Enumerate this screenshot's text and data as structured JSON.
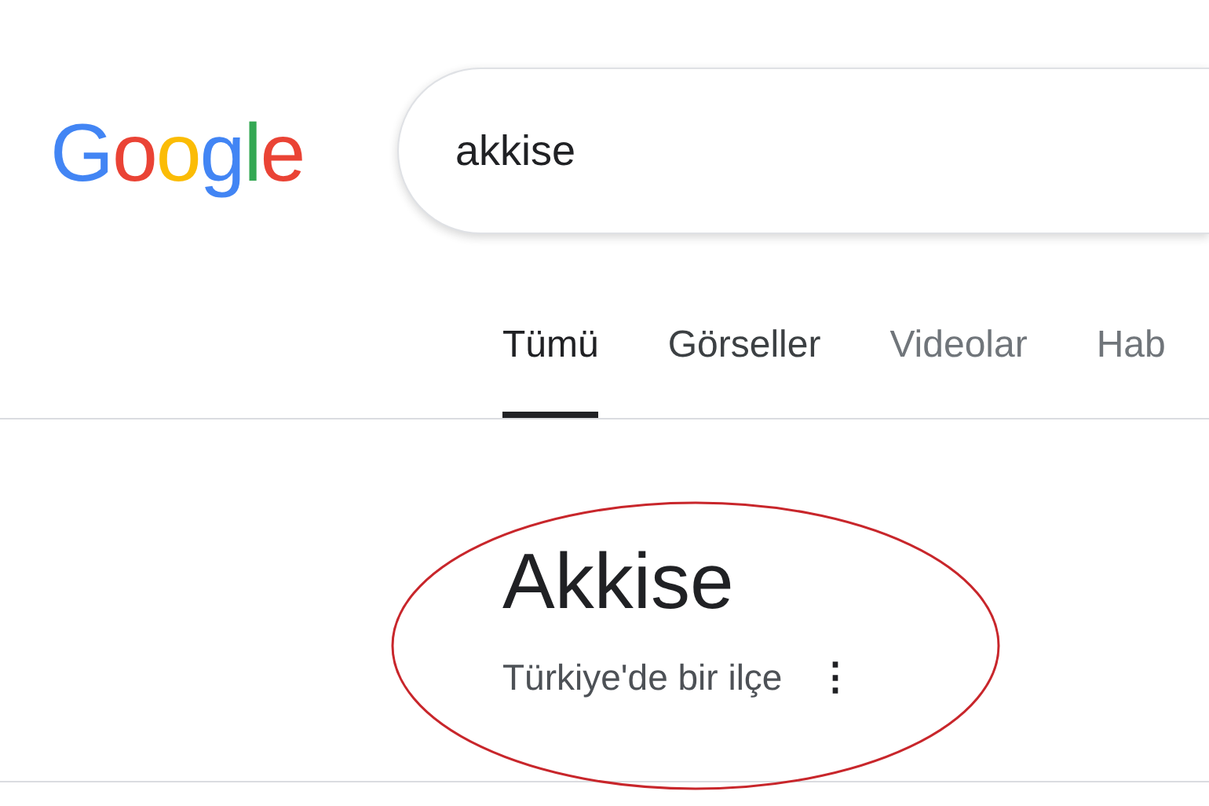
{
  "logo": {
    "letters": [
      {
        "text": "G",
        "color": "#4285f4"
      },
      {
        "text": "o",
        "color": "#ea4335"
      },
      {
        "text": "o",
        "color": "#fbbc05"
      },
      {
        "text": "g",
        "color": "#4285f4"
      },
      {
        "text": "l",
        "color": "#34a853"
      },
      {
        "text": "e",
        "color": "#ea4335"
      }
    ]
  },
  "search": {
    "value": "akkise"
  },
  "tabs": [
    {
      "label": "Tümü",
      "selected": true
    },
    {
      "label": "Görseller",
      "selected": false
    },
    {
      "label": "Videolar",
      "selected": false
    },
    {
      "label": "Hab",
      "selected": false
    }
  ],
  "result": {
    "title": "Akkise",
    "subtitle": "Türkiye'de bir ilçe",
    "more_icon": "⋮"
  },
  "annotation": {
    "kind": "ellipse",
    "color": "#c8262b"
  }
}
